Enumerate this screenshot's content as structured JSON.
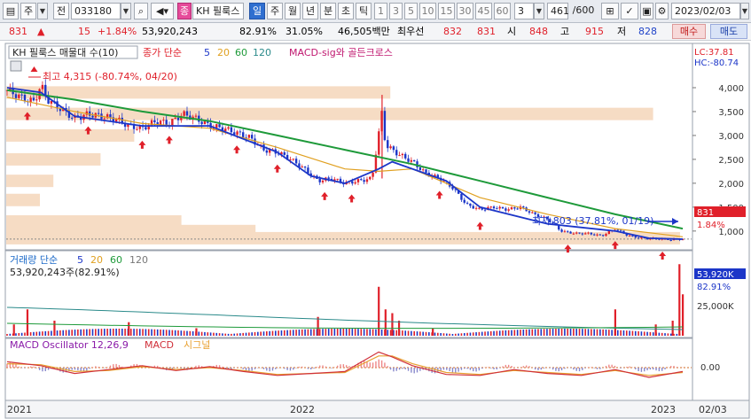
{
  "toolbar": {
    "market_toggle": "주",
    "range_label": "전",
    "code": "033180",
    "kind_badge": "종",
    "name": "KH 필룩스",
    "periods": [
      "일",
      "주",
      "월",
      "년",
      "분",
      "초",
      "틱"
    ],
    "numbers": [
      "1",
      "3",
      "5",
      "10",
      "15",
      "30",
      "45",
      "60"
    ],
    "count_select": "3",
    "paging_value": "461",
    "paging_total": "/600",
    "date": "2023/02/03"
  },
  "quote": {
    "price": "831",
    "change": "15",
    "change_pct": "+1.84%",
    "volume": "53,920,243",
    "volume_pct": "82.91%",
    "turnover_pct": "31.05%",
    "amount": "46,505백만",
    "best_bid_label": "최우선",
    "best_ask": "832",
    "best_bid": "831",
    "open_label": "시",
    "open": "848",
    "high_label": "고",
    "high": "915",
    "low_label": "저",
    "low": "828",
    "buy_label": "매수",
    "sell_label": "매도"
  },
  "legend": {
    "title": "KH 필룩스 매물대 수(10)",
    "ma_label": "종가 단순",
    "ma_periods": [
      "5",
      "20",
      "60",
      "120"
    ],
    "signal_label": "MACD-sig와 골든크로스",
    "lc": "LC:37.81",
    "hc": "HC:-80.74",
    "high_note": "최고 4,315 (-80.74%, 04/20)",
    "low_note": "최저 803 (37.81%, 01/19)",
    "last_price": "831",
    "last_pct": "1.84%"
  },
  "volume_legend": {
    "title": "거래량 단순",
    "periods": [
      "5",
      "20",
      "60",
      "120"
    ],
    "value_line": "53,920,243주(82.91%)",
    "right_value": "53,920K",
    "right_pct": "82.91%",
    "tick_25k": "25,000K"
  },
  "macd_legend": {
    "title": "MACD Oscillator 12,26,9",
    "macd": "MACD",
    "signal": "시그널",
    "zero_tick": "0.00"
  },
  "xaxis": {
    "labels": [
      "2021",
      "2022",
      "2023"
    ],
    "right_date": "02/03"
  },
  "colors": {
    "up": "#e0202a",
    "down": "#1c36c8",
    "ma5": "#1c36c8",
    "ma20": "#e0a020",
    "ma60": "#1e9a3a",
    "volume_profile": "#f6dcc4",
    "macd": "#d0303a",
    "signal": "#e8a030",
    "accent": "#2f6fd0"
  },
  "chart_data": [
    {
      "type": "candlestick",
      "title": "KH 필룩스 매물대 수(10)",
      "yaxis_ticks": [
        "4,000",
        "3,500",
        "3,000",
        "2,500",
        "2,000",
        "1,500",
        "1,000"
      ],
      "ylim": [
        700,
        4500
      ],
      "x_labels": [
        "2021",
        "2022",
        "2023"
      ],
      "close_path": [
        [
          0,
          3950
        ],
        [
          0.02,
          3800
        ],
        [
          0.04,
          3700
        ],
        [
          0.05,
          4050
        ],
        [
          0.06,
          3750
        ],
        [
          0.08,
          3550
        ],
        [
          0.1,
          3350
        ],
        [
          0.12,
          3450
        ],
        [
          0.14,
          3400
        ],
        [
          0.16,
          3350
        ],
        [
          0.18,
          3200
        ],
        [
          0.2,
          3150
        ],
        [
          0.22,
          3300
        ],
        [
          0.24,
          3250
        ],
        [
          0.26,
          3450
        ],
        [
          0.28,
          3350
        ],
        [
          0.3,
          3200
        ],
        [
          0.32,
          3150
        ],
        [
          0.34,
          3050
        ],
        [
          0.36,
          2950
        ],
        [
          0.38,
          2700
        ],
        [
          0.4,
          2650
        ],
        [
          0.42,
          2500
        ],
        [
          0.44,
          2300
        ],
        [
          0.46,
          2050
        ],
        [
          0.48,
          2100
        ],
        [
          0.5,
          2000
        ],
        [
          0.52,
          2050
        ],
        [
          0.54,
          2100
        ],
        [
          0.555,
          3500
        ],
        [
          0.56,
          2800
        ],
        [
          0.58,
          2600
        ],
        [
          0.6,
          2450
        ],
        [
          0.62,
          2200
        ],
        [
          0.64,
          2100
        ],
        [
          0.66,
          1900
        ],
        [
          0.68,
          1550
        ],
        [
          0.7,
          1450
        ],
        [
          0.72,
          1500
        ],
        [
          0.74,
          1450
        ],
        [
          0.76,
          1500
        ],
        [
          0.78,
          1350
        ],
        [
          0.8,
          1250
        ],
        [
          0.82,
          1000
        ],
        [
          0.84,
          950
        ],
        [
          0.86,
          950
        ],
        [
          0.88,
          900
        ],
        [
          0.9,
          1050
        ],
        [
          0.92,
          900
        ],
        [
          0.94,
          850
        ],
        [
          0.96,
          840
        ],
        [
          0.98,
          820
        ],
        [
          1.0,
          831
        ]
      ],
      "series": [
        {
          "name": "5",
          "color": "#1c36c8"
        },
        {
          "name": "20",
          "color": "#e0a020"
        },
        {
          "name": "60",
          "color": "#1e9a3a"
        }
      ],
      "ma60_path": [
        [
          0,
          3950
        ],
        [
          0.1,
          3750
        ],
        [
          0.2,
          3500
        ],
        [
          0.3,
          3300
        ],
        [
          0.4,
          3000
        ],
        [
          0.5,
          2700
        ],
        [
          0.6,
          2400
        ],
        [
          0.7,
          2050
        ],
        [
          0.8,
          1700
        ],
        [
          0.9,
          1350
        ],
        [
          1.0,
          1050
        ]
      ],
      "ma20_path": [
        [
          0,
          3800
        ],
        [
          0.1,
          3500
        ],
        [
          0.2,
          3250
        ],
        [
          0.3,
          3150
        ],
        [
          0.4,
          2750
        ],
        [
          0.5,
          2300
        ],
        [
          0.55,
          2250
        ],
        [
          0.6,
          2300
        ],
        [
          0.7,
          1700
        ],
        [
          0.8,
          1350
        ],
        [
          0.9,
          1050
        ],
        [
          1.0,
          880
        ]
      ],
      "ma5_path": [
        [
          0,
          4000
        ],
        [
          0.05,
          3900
        ],
        [
          0.1,
          3400
        ],
        [
          0.2,
          3200
        ],
        [
          0.3,
          3200
        ],
        [
          0.4,
          2650
        ],
        [
          0.45,
          2150
        ],
        [
          0.5,
          2000
        ],
        [
          0.55,
          2300
        ],
        [
          0.57,
          2450
        ],
        [
          0.65,
          2050
        ],
        [
          0.7,
          1500
        ],
        [
          0.8,
          1150
        ],
        [
          0.9,
          1000
        ],
        [
          0.95,
          850
        ],
        [
          1.0,
          830
        ]
      ],
      "signal_arrows": [
        0.03,
        0.12,
        0.2,
        0.24,
        0.34,
        0.4,
        0.47,
        0.51,
        0.64,
        0.7,
        0.83,
        0.9,
        0.97
      ],
      "volume_profile_rows": [
        {
          "price": 3900,
          "size": 0.57
        },
        {
          "price": 3450,
          "size": 0.96
        },
        {
          "price": 3000,
          "size": 0.19
        },
        {
          "price": 2500,
          "size": 0.14
        },
        {
          "price": 2050,
          "size": 0.07
        },
        {
          "price": 1650,
          "size": 0.05
        },
        {
          "price": 1200,
          "size": 0.26
        },
        {
          "price": 1000,
          "size": 0.37
        },
        {
          "price": 850,
          "size": 1.0
        }
      ]
    },
    {
      "type": "bar",
      "title": "거래량",
      "spikes": [
        [
          0.01,
          0.15
        ],
        [
          0.03,
          0.35
        ],
        [
          0.07,
          0.2
        ],
        [
          0.18,
          0.18
        ],
        [
          0.28,
          0.1
        ],
        [
          0.46,
          0.25
        ],
        [
          0.55,
          0.65
        ],
        [
          0.56,
          0.35
        ],
        [
          0.57,
          0.3
        ],
        [
          0.58,
          0.2
        ],
        [
          0.63,
          0.1
        ],
        [
          0.9,
          0.35
        ],
        [
          0.96,
          0.15
        ],
        [
          0.985,
          0.2
        ],
        [
          0.995,
          0.95
        ],
        [
          1.0,
          0.55
        ]
      ]
    },
    {
      "type": "line",
      "title": "MACD Oscillator 12,26,9",
      "macd_path": [
        [
          0,
          0.3
        ],
        [
          0.05,
          0.1
        ],
        [
          0.1,
          -0.3
        ],
        [
          0.15,
          -0.1
        ],
        [
          0.2,
          0.1
        ],
        [
          0.25,
          -0.15
        ],
        [
          0.3,
          0.05
        ],
        [
          0.35,
          -0.2
        ],
        [
          0.4,
          -0.4
        ],
        [
          0.45,
          -0.3
        ],
        [
          0.5,
          -0.2
        ],
        [
          0.55,
          0.8
        ],
        [
          0.57,
          0.55
        ],
        [
          0.6,
          0.1
        ],
        [
          0.65,
          -0.35
        ],
        [
          0.7,
          -0.4
        ],
        [
          0.75,
          -0.1
        ],
        [
          0.8,
          -0.3
        ],
        [
          0.85,
          -0.4
        ],
        [
          0.9,
          -0.1
        ],
        [
          0.95,
          -0.5
        ],
        [
          1.0,
          -0.2
        ]
      ],
      "signal_path": [
        [
          0,
          0.2
        ],
        [
          0.05,
          0.15
        ],
        [
          0.1,
          -0.2
        ],
        [
          0.15,
          -0.15
        ],
        [
          0.2,
          0.05
        ],
        [
          0.25,
          -0.1
        ],
        [
          0.3,
          0.0
        ],
        [
          0.35,
          -0.15
        ],
        [
          0.4,
          -0.35
        ],
        [
          0.45,
          -0.3
        ],
        [
          0.5,
          -0.25
        ],
        [
          0.55,
          0.6
        ],
        [
          0.57,
          0.6
        ],
        [
          0.6,
          0.2
        ],
        [
          0.65,
          -0.25
        ],
        [
          0.7,
          -0.35
        ],
        [
          0.75,
          -0.15
        ],
        [
          0.8,
          -0.25
        ],
        [
          0.85,
          -0.35
        ],
        [
          0.9,
          -0.15
        ],
        [
          0.95,
          -0.4
        ],
        [
          1.0,
          -0.25
        ]
      ]
    }
  ]
}
